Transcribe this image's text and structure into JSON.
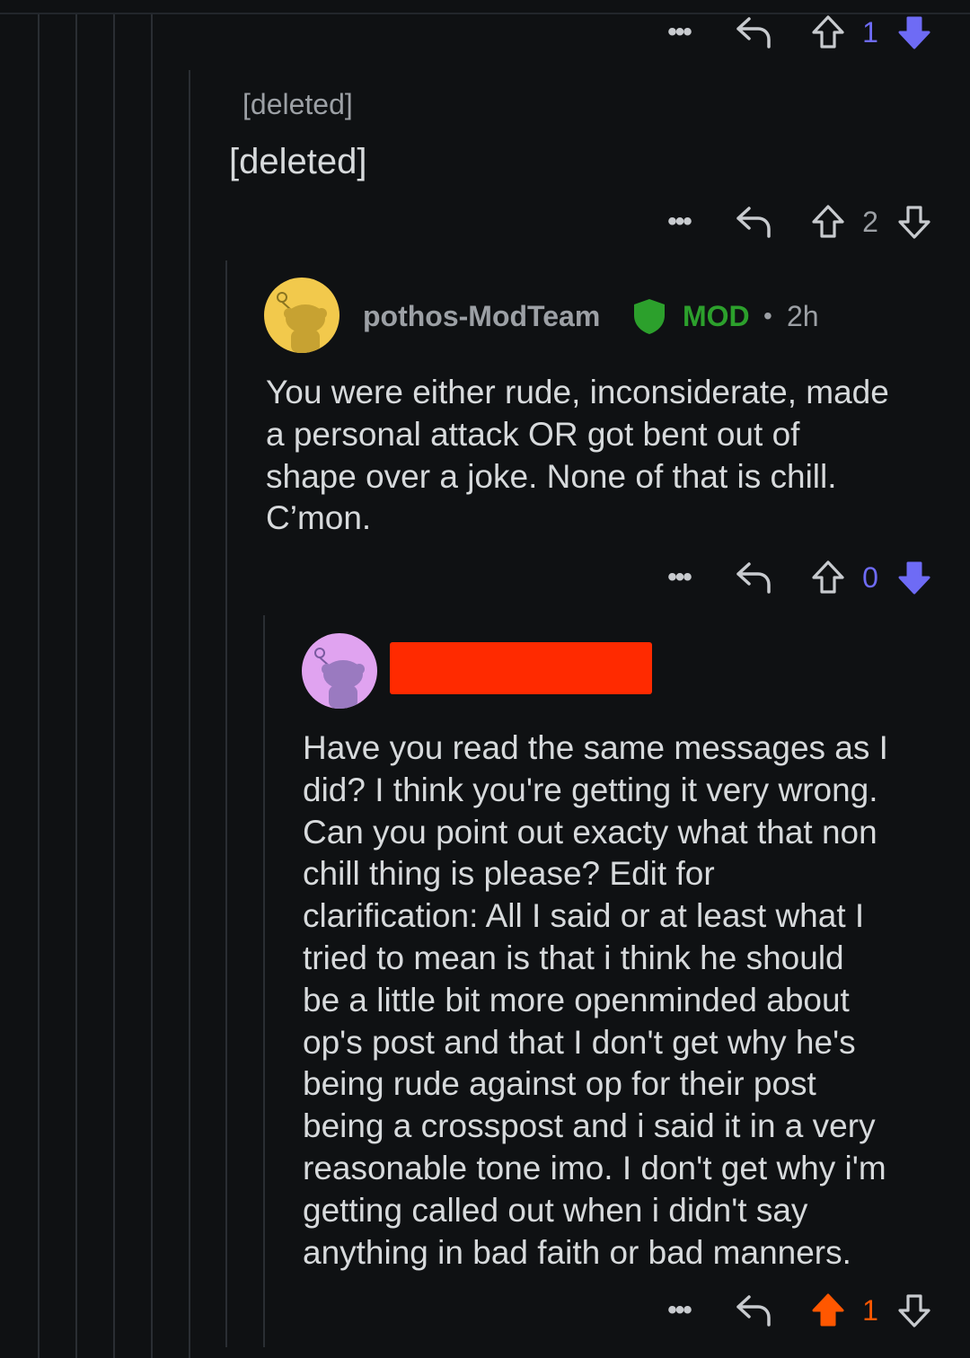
{
  "comments": {
    "top_actions": {
      "vote_count": "1",
      "vote_color": "#6e6bf5"
    },
    "deleted": {
      "author": "[deleted]",
      "body": "[deleted]",
      "vote_count": "2"
    },
    "mod": {
      "author": "pothos-ModTeam",
      "badge": "MOD",
      "separator": "•",
      "time": "2h",
      "body": "You were either rude, inconsiderate, made\na personal attack OR got bent out of\nshape over a joke. None of that is chill.\nC’mon.",
      "vote_count": "0",
      "vote_color": "#6e6bf5",
      "badge_color": "#2ca02c",
      "avatar_color": "#f2c94c"
    },
    "reply": {
      "author_redacted_color": "#ff2a00",
      "body": "Have you read the same messages as I\ndid? I think you're getting it very wrong.\nCan you point out exacty what that non\nchill thing is please? Edit for\nclarification: All I said or at least what I\ntried to mean is that i think he should\nbe a little bit more openminded about\nop's post and that I don't get why he's\nbeing rude against op for their post\nbeing a crosspost and i said it in a very\nreasonable tone imo. I don't get why i'm\ngetting called out when i didn't say\nanything in bad faith or bad manners.",
      "vote_count": "1",
      "vote_color": "#ff5700",
      "avatar_color": "#e0a3f0"
    }
  }
}
